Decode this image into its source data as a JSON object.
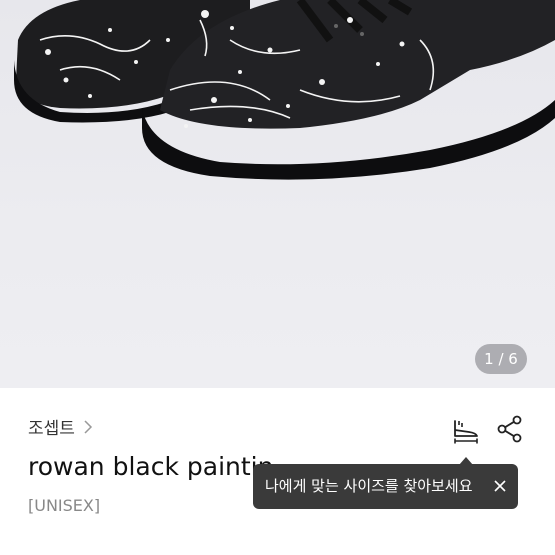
{
  "photo": {
    "counter": "1 / 6"
  },
  "product": {
    "brand": "조셉트",
    "title": "rowan black paintin",
    "gender": "[UNISEX]"
  },
  "tooltip": {
    "text": "나에게 맞는 사이즈를 찾아보세요"
  },
  "icons": {
    "brand_arrow": "chevron-right-icon",
    "size": "shoe-size-icon",
    "share": "share-icon",
    "close": "close-icon"
  },
  "colors": {
    "tooltip_bg": "#3a3a3a",
    "counter_bg": "#8a8a8e"
  }
}
